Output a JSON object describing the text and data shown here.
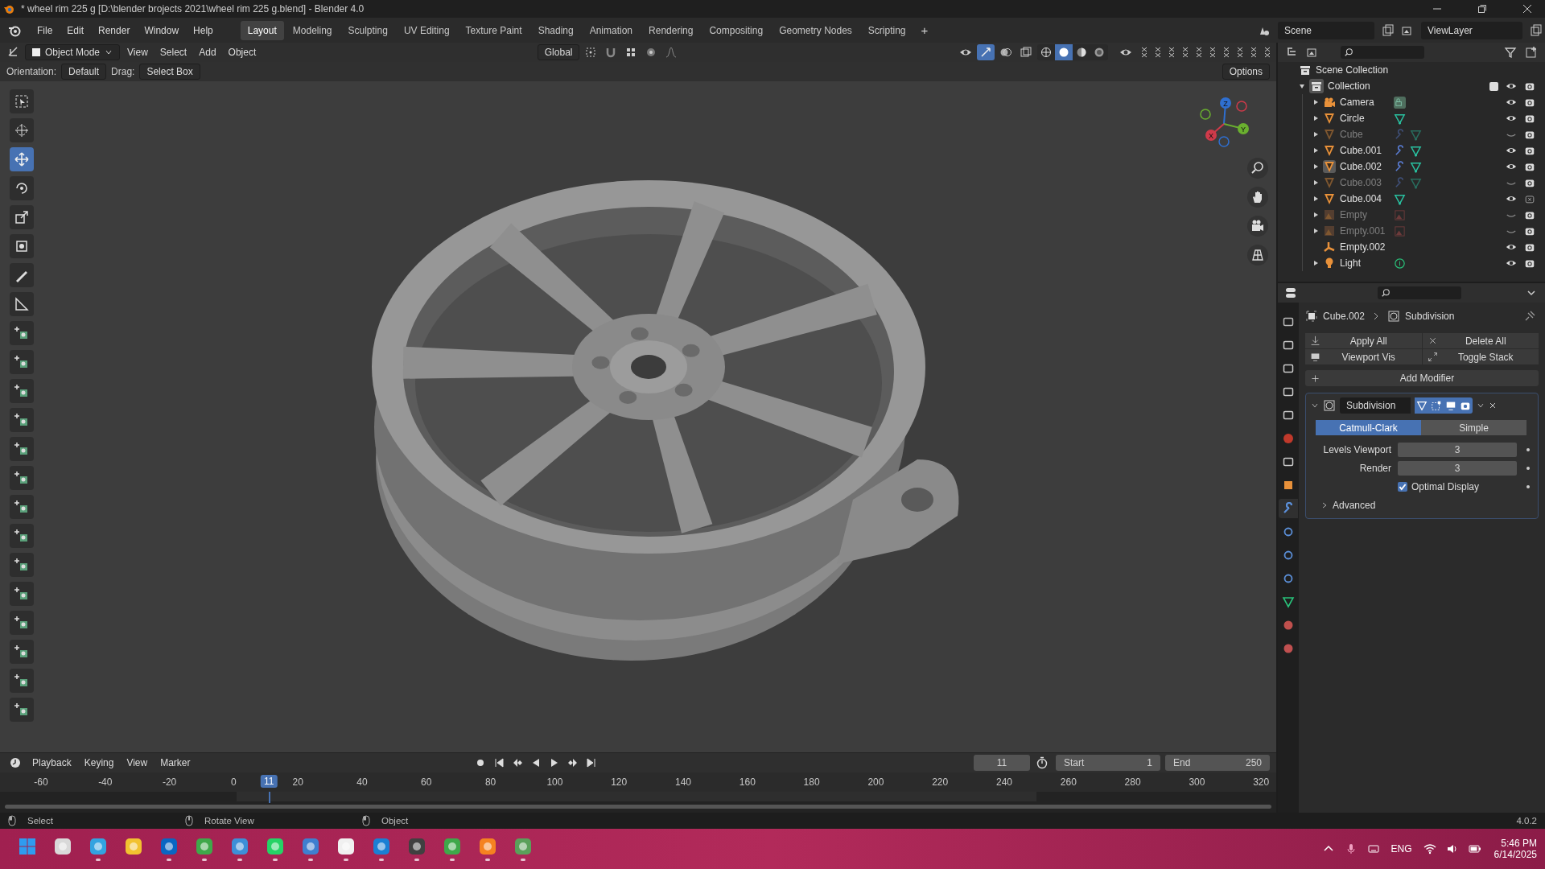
{
  "window": {
    "title": "* wheel rim 225 g [D:\\blender brojects 2021\\wheel rim 225 g.blend] - Blender 4.0"
  },
  "menu": [
    "File",
    "Edit",
    "Render",
    "Window",
    "Help"
  ],
  "workspaces": [
    {
      "label": "Layout",
      "selected": true
    },
    {
      "label": "Modeling",
      "selected": false
    },
    {
      "label": "Sculpting",
      "selected": false
    },
    {
      "label": "UV Editing",
      "selected": false
    },
    {
      "label": "Texture Paint",
      "selected": false
    },
    {
      "label": "Shading",
      "selected": false
    },
    {
      "label": "Animation",
      "selected": false
    },
    {
      "label": "Rendering",
      "selected": false
    },
    {
      "label": "Compositing",
      "selected": false
    },
    {
      "label": "Geometry Nodes",
      "selected": false
    },
    {
      "label": "Scripting",
      "selected": false
    }
  ],
  "add_workspace": "+",
  "scene": "Scene",
  "view_layer": "ViewLayer",
  "viewport_header": {
    "mode": "Object Mode",
    "menus": [
      "View",
      "Select",
      "Add",
      "Object"
    ],
    "transform": "Global",
    "gizmos_on": true,
    "shading": [
      {
        "kind": "wireframe",
        "selected": false
      },
      {
        "kind": "solid",
        "selected": true
      },
      {
        "kind": "material",
        "selected": false
      },
      {
        "kind": "rendered",
        "selected": false
      }
    ]
  },
  "tool_settings": {
    "orientation_label": "Orientation:",
    "orientation": "Default",
    "drag_label": "Drag:",
    "drag": "Select Box",
    "options": "Options"
  },
  "toolbar": [
    {
      "kind": "select",
      "selected": false
    },
    {
      "kind": "cursor",
      "selected": false
    },
    {
      "kind": "move",
      "selected": true
    },
    {
      "kind": "rotate",
      "selected": false
    },
    {
      "kind": "scale",
      "selected": false
    },
    {
      "kind": "transform",
      "selected": false
    },
    {
      "kind": "annotate",
      "selected": false
    },
    {
      "kind": "measure",
      "selected": false
    },
    {
      "kind": "add",
      "selected": false
    },
    {
      "kind": "add",
      "selected": false
    },
    {
      "kind": "add",
      "selected": false
    },
    {
      "kind": "add",
      "selected": false
    },
    {
      "kind": "add",
      "selected": false
    },
    {
      "kind": "add",
      "selected": false
    },
    {
      "kind": "add",
      "selected": false
    },
    {
      "kind": "add",
      "selected": false
    },
    {
      "kind": "add",
      "selected": false
    },
    {
      "kind": "add",
      "selected": false
    },
    {
      "kind": "add",
      "selected": false
    },
    {
      "kind": "add",
      "selected": false
    },
    {
      "kind": "add",
      "selected": false
    },
    {
      "kind": "add",
      "selected": false
    }
  ],
  "gizmo": {
    "axes": [
      "Z",
      "Y",
      "X"
    ]
  },
  "outliner": {
    "root": "Scene Collection",
    "collection": {
      "label": "Collection",
      "expanded": true,
      "checked": true,
      "children": [
        {
          "label": "Camera",
          "kind": "camera",
          "badges": [
            {
              "kind": "camera-data"
            }
          ],
          "visible": true,
          "renderable": true,
          "active": false,
          "expandable": true
        },
        {
          "label": "Circle",
          "kind": "mesh",
          "badges": [
            {
              "kind": "mesh-data"
            }
          ],
          "visible": true,
          "renderable": true,
          "active": false,
          "expandable": true
        },
        {
          "label": "Cube",
          "kind": "mesh",
          "badges": [
            {
              "kind": "modifier"
            },
            {
              "kind": "mesh-data"
            }
          ],
          "visible": false,
          "renderable": true,
          "active": false,
          "expandable": true
        },
        {
          "label": "Cube.001",
          "kind": "mesh",
          "badges": [
            {
              "kind": "modifier"
            },
            {
              "kind": "mesh-data"
            }
          ],
          "visible": true,
          "renderable": true,
          "active": false,
          "expandable": true
        },
        {
          "label": "Cube.002",
          "kind": "mesh",
          "badges": [
            {
              "kind": "modifier"
            },
            {
              "kind": "mesh-data"
            }
          ],
          "visible": true,
          "renderable": true,
          "active": true,
          "expandable": true
        },
        {
          "label": "Cube.003",
          "kind": "mesh",
          "badges": [
            {
              "kind": "modifier"
            },
            {
              "kind": "mesh-data"
            }
          ],
          "visible": false,
          "renderable": true,
          "active": false,
          "expandable": true
        },
        {
          "label": "Cube.004",
          "kind": "mesh",
          "badges": [
            {
              "kind": "mesh-data"
            }
          ],
          "visible": true,
          "renderable": false,
          "active": false,
          "expandable": true
        },
        {
          "label": "Empty",
          "kind": "image-empty",
          "badges": [
            {
              "kind": "image-data"
            }
          ],
          "visible": false,
          "renderable": true,
          "active": false,
          "expandable": true
        },
        {
          "label": "Empty.001",
          "kind": "image-empty",
          "badges": [
            {
              "kind": "image-data"
            }
          ],
          "visible": false,
          "renderable": true,
          "active": false,
          "expandable": true
        },
        {
          "label": "Empty.002",
          "kind": "empty",
          "visible": true,
          "renderable": true,
          "active": false,
          "expandable": false
        },
        {
          "label": "Light",
          "kind": "light",
          "badges": [
            {
              "kind": "light-data"
            }
          ],
          "visible": true,
          "renderable": true,
          "active": false,
          "expandable": true
        }
      ]
    }
  },
  "properties": {
    "tabs": [
      {
        "kind": "tool",
        "selected": false
      },
      {
        "kind": "render",
        "selected": false
      },
      {
        "kind": "output",
        "selected": false
      },
      {
        "kind": "view-layer",
        "selected": false
      },
      {
        "kind": "scene",
        "selected": false
      },
      {
        "kind": "world",
        "selected": false
      },
      {
        "kind": "collection",
        "selected": false
      },
      {
        "kind": "object",
        "selected": false
      },
      {
        "kind": "modifier",
        "selected": true
      },
      {
        "kind": "particles",
        "selected": false
      },
      {
        "kind": "physics",
        "selected": false
      },
      {
        "kind": "constraints",
        "selected": false
      },
      {
        "kind": "data",
        "selected": false
      },
      {
        "kind": "material",
        "selected": false
      },
      {
        "kind": "texture",
        "selected": false
      }
    ],
    "object": "Cube.002",
    "modifier": "Subdivision",
    "actions": [
      {
        "kind": "apply",
        "label": "Apply All"
      },
      {
        "kind": "delete",
        "label": "Delete All"
      },
      {
        "kind": "viewport",
        "label": "Viewport Vis"
      },
      {
        "kind": "toggle",
        "label": "Toggle Stack"
      }
    ],
    "add_modifier": "Add Modifier",
    "panel": {
      "name": "Subdivision",
      "expanded": true,
      "types": [
        {
          "label": "Catmull-Clark",
          "selected": true
        },
        {
          "label": "Simple",
          "selected": false
        }
      ],
      "fields": [
        {
          "label": "Levels Viewport",
          "value": "3"
        },
        {
          "label": "Render",
          "value": "3"
        }
      ],
      "optimal_display": {
        "label": "Optimal Display",
        "checked": true
      },
      "advanced": {
        "label": "Advanced",
        "expanded": false
      }
    }
  },
  "timeline": {
    "menus": [
      "Playback",
      "Keying",
      "View",
      "Marker"
    ],
    "current_frame": "11",
    "start_label": "Start",
    "start": "1",
    "end_label": "End",
    "end": "250",
    "ticks": [
      "-60",
      "-40",
      "-20",
      "0",
      "20",
      "40",
      "60",
      "80",
      "100",
      "120",
      "140",
      "160",
      "180",
      "200",
      "220",
      "240",
      "260",
      "280",
      "300",
      "320"
    ],
    "playhead": "11"
  },
  "status_bar": {
    "hints": [
      "Select",
      "Rotate View",
      "Object"
    ],
    "version": "4.0.2"
  },
  "taskbar": {
    "apps": [
      {
        "kind": "start",
        "color": "#2f9bf0",
        "running": false
      },
      {
        "kind": "app",
        "color": "#d9d9d9",
        "running": false
      },
      {
        "kind": "app",
        "color": "#33a3e0",
        "running": true
      },
      {
        "kind": "app",
        "color": "#f2c230",
        "running": false
      },
      {
        "kind": "app",
        "color": "#0a66c2",
        "running": true
      },
      {
        "kind": "app",
        "color": "#3fa84a",
        "running": true
      },
      {
        "kind": "app",
        "color": "#3d8fd8",
        "running": true
      },
      {
        "kind": "app",
        "color": "#25d366",
        "running": true
      },
      {
        "kind": "app",
        "color": "#3f7fd0",
        "running": true
      },
      {
        "kind": "app",
        "color": "#f0f0f0",
        "running": true
      },
      {
        "kind": "app",
        "color": "#1a7fd4",
        "running": true
      },
      {
        "kind": "app",
        "color": "#404040",
        "running": true
      },
      {
        "kind": "app",
        "color": "#3fa84a",
        "running": true
      },
      {
        "kind": "app",
        "color": "#f58220",
        "running": true
      },
      {
        "kind": "app",
        "color": "#5aa05a",
        "running": true
      }
    ],
    "language": "ENG",
    "time": "5:46 PM",
    "date": "6/14/2025"
  }
}
